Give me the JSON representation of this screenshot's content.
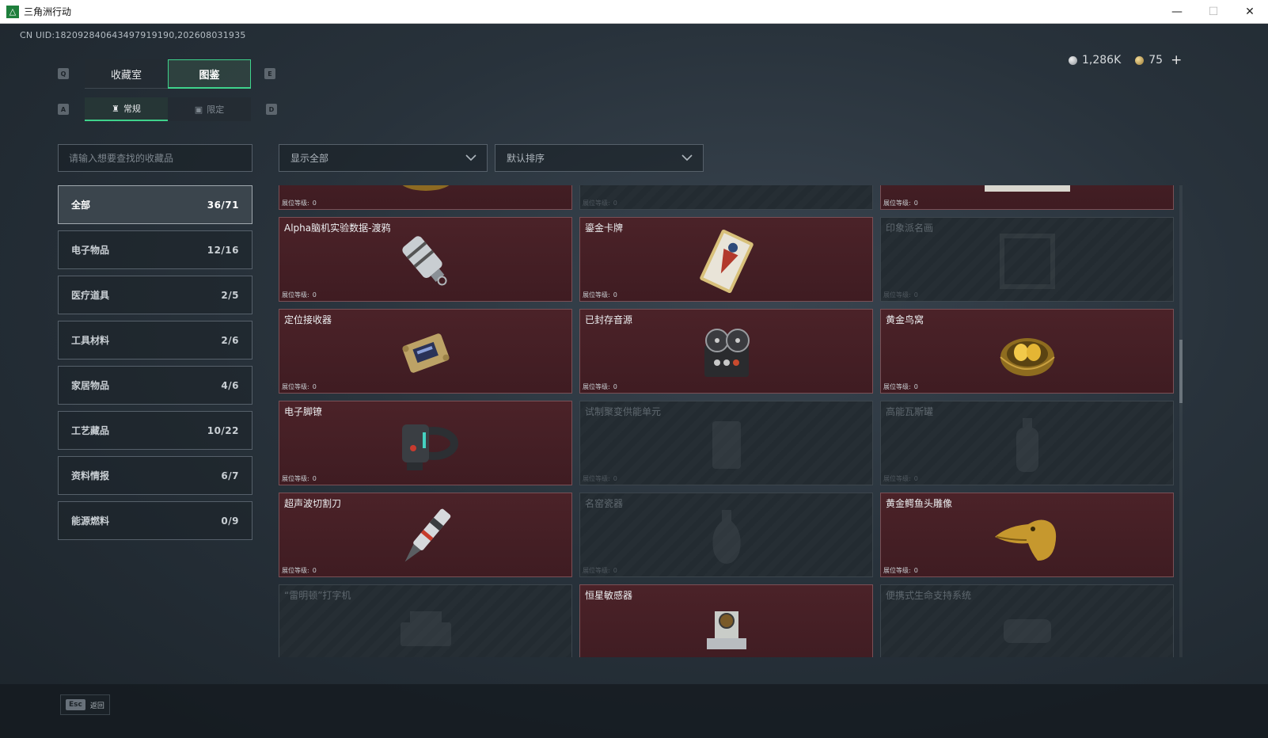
{
  "window": {
    "title": "三角洲行动",
    "logo": "delta-logo-icon"
  },
  "uid": "CN UID:182092840643497919190,202608031935",
  "currency": {
    "silver": "1,286K",
    "gold": "75"
  },
  "keys": {
    "prev_tab": "Q",
    "next_tab": "E",
    "prev_sub": "A",
    "next_sub": "D"
  },
  "tabs": [
    {
      "label": "收藏室"
    },
    {
      "label": "图鉴"
    }
  ],
  "subtabs": [
    {
      "label": "常规"
    },
    {
      "label": "限定"
    }
  ],
  "search": {
    "placeholder": "请输入想要查找的收藏品"
  },
  "filter": {
    "value": "显示全部"
  },
  "sort": {
    "value": "默认排序"
  },
  "categories": [
    {
      "label": "全部",
      "count": "36/71"
    },
    {
      "label": "电子物品",
      "count": "12/16"
    },
    {
      "label": "医疗道具",
      "count": "2/5"
    },
    {
      "label": "工具材料",
      "count": "2/6"
    },
    {
      "label": "家居物品",
      "count": "4/6"
    },
    {
      "label": "工艺藏品",
      "count": "10/22"
    },
    {
      "label": "资料情报",
      "count": "6/7"
    },
    {
      "label": "能源燃料",
      "count": "0/9"
    }
  ],
  "level_label": "展位等级:",
  "items": [
    {
      "name": "",
      "level": "0",
      "owned": true,
      "icon": "caviar-tin-icon"
    },
    {
      "name": "",
      "level": "0",
      "owned": false,
      "icon": "hidden-item-icon"
    },
    {
      "name": "",
      "level": "0",
      "owned": true,
      "icon": "blueprint-icon"
    },
    {
      "name": "Alpha脑机实验数据-渡鸦",
      "level": "0",
      "owned": true,
      "icon": "data-capsule-icon"
    },
    {
      "name": "鎏金卡牌",
      "level": "0",
      "owned": true,
      "icon": "gilded-card-icon"
    },
    {
      "name": "印象派名画",
      "level": "0",
      "owned": false,
      "icon": "painting-icon"
    },
    {
      "name": "定位接收器",
      "level": "0",
      "owned": true,
      "icon": "receiver-icon"
    },
    {
      "name": "已封存音源",
      "level": "0",
      "owned": true,
      "icon": "reel-recorder-icon"
    },
    {
      "name": "黄金鸟窝",
      "level": "0",
      "owned": true,
      "icon": "golden-nest-icon"
    },
    {
      "name": "电子脚镣",
      "level": "0",
      "owned": true,
      "icon": "ankle-monitor-icon"
    },
    {
      "name": "试制聚变供能单元",
      "level": "0",
      "owned": false,
      "icon": "fusion-cell-icon"
    },
    {
      "name": "高能瓦斯罐",
      "level": "0",
      "owned": false,
      "icon": "gas-canister-icon"
    },
    {
      "name": "超声波切割刀",
      "level": "0",
      "owned": true,
      "icon": "ultrasonic-knife-icon"
    },
    {
      "name": "名窑瓷器",
      "level": "0",
      "owned": false,
      "icon": "porcelain-vase-icon"
    },
    {
      "name": "黄金鳄鱼头雕像",
      "level": "0",
      "owned": true,
      "icon": "golden-crocodile-icon"
    },
    {
      "name": "“雷明顿”打字机",
      "level": "0",
      "owned": false,
      "icon": "typewriter-icon"
    },
    {
      "name": "恒星敏感器",
      "level": "0",
      "owned": true,
      "icon": "star-sensor-icon"
    },
    {
      "name": "便携式生命支持系统",
      "level": "0",
      "owned": false,
      "icon": "life-support-icon"
    }
  ],
  "footer": {
    "key": "Esc",
    "label": "返回"
  }
}
